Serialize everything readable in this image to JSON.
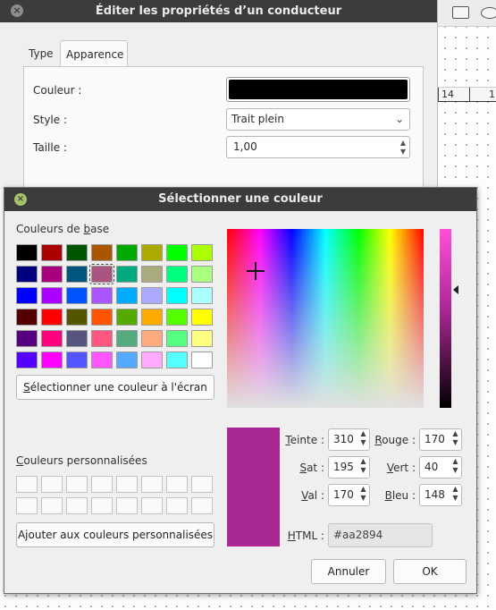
{
  "background": {
    "ruler_labels": [
      "14",
      "1"
    ]
  },
  "conductor_dialog": {
    "title": "Éditer les propriétés d’un conducteur",
    "tabs": [
      "Type",
      "Apparence"
    ],
    "active_tab": "Apparence",
    "color_label": "Couleur :",
    "color_value": "#000000",
    "style_label": "Style :",
    "style_value": "Trait plein",
    "size_label": "Taille :",
    "size_value": "1,00"
  },
  "color_dialog": {
    "title": "Sélectionner une couleur",
    "basic_colors_label_pre": "Couleurs de ",
    "basic_colors_label_u": "b",
    "basic_colors_label_post": "ase",
    "basic_colors": [
      [
        "#000000",
        "#aa0000",
        "#005500",
        "#aa5500",
        "#00aa00",
        "#aaaa00",
        "#00ff00",
        "#aaff00"
      ],
      [
        "#00007f",
        "#aa007f",
        "#00557f",
        "#aa557f",
        "#00aa7f",
        "#aaaa7f",
        "#00ff7f",
        "#aaff7f"
      ],
      [
        "#0000ff",
        "#aa00ff",
        "#0055ff",
        "#aa55ff",
        "#00aaff",
        "#aaaaff",
        "#00ffff",
        "#aaffff"
      ],
      [
        "#550000",
        "#ff0000",
        "#555500",
        "#ff5500",
        "#55aa00",
        "#ffaa00",
        "#55ff00",
        "#ffff00"
      ],
      [
        "#55007f",
        "#ff007f",
        "#55557f",
        "#ff557f",
        "#55aa7f",
        "#ffaa7f",
        "#55ff7f",
        "#ffff7f"
      ],
      [
        "#5500ff",
        "#ff00ff",
        "#5555ff",
        "#ff55ff",
        "#55aaff",
        "#ffaaff",
        "#55ffff",
        "#ffffff"
      ]
    ],
    "screen_pick_label_u": "S",
    "screen_pick_label_rest": "électionner une couleur à l'écran",
    "custom_colors_label_u": "C",
    "custom_colors_label_rest": "ouleurs personnalisées",
    "add_custom_label_pre": "A",
    "add_custom_label_u": "j",
    "add_custom_label_rest": "outer aux couleurs personnalisées",
    "preview_color": "#aa2894",
    "hue_label_u": "T",
    "hue_label_rest": "einte :",
    "hue_value": "310",
    "sat_label_u": "S",
    "sat_label_rest": "at :",
    "sat_value": "195",
    "val_label_u": "V",
    "val_label_rest": "al :",
    "val_value": "170",
    "red_label_u": "R",
    "red_label_rest": "ouge :",
    "red_value": "170",
    "green_label_u": "V",
    "green_label_rest": "ert :",
    "green_value": "40",
    "blue_label_u": "B",
    "blue_label_rest": "leu :",
    "blue_value": "148",
    "html_label_u": "H",
    "html_label_rest": "TML :",
    "html_value": "#aa2894",
    "cancel_label": "Annuler",
    "ok_label": "OK"
  }
}
